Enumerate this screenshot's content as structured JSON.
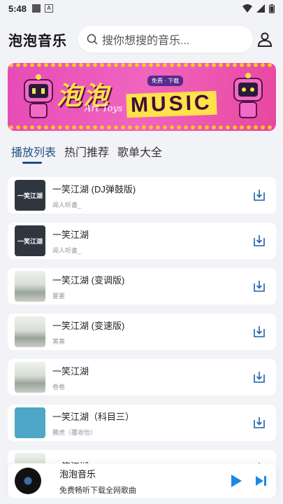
{
  "status": {
    "time": "5:48"
  },
  "header": {
    "title": "泡泡音乐"
  },
  "search": {
    "placeholder": "搜你想搜的音乐..."
  },
  "banner": {
    "title": "泡泡",
    "music": "MUSIC",
    "sub": "Art Toys",
    "pill": "免费 · 下载"
  },
  "tabs": [
    {
      "label": "播放列表",
      "active": true
    },
    {
      "label": "热门推荐",
      "active": false
    },
    {
      "label": "歌单大全",
      "active": false
    }
  ],
  "songs": [
    {
      "title": "一笑江湖 (DJ弹鼓版)",
      "artist": "闻人听書_",
      "cover": "dark",
      "cover_text": "一笑江湖"
    },
    {
      "title": "一笑江湖",
      "artist": "闻人听書_",
      "cover": "dark",
      "cover_text": "一笑江湖"
    },
    {
      "title": "一笑江湖 (变调版)",
      "artist": "要要",
      "cover": "ink",
      "cover_text": ""
    },
    {
      "title": "一笑江湖 (变速版)",
      "artist": "黄黄",
      "cover": "ink",
      "cover_text": ""
    },
    {
      "title": "一笑江湖",
      "artist": "卷卷",
      "cover": "ink",
      "cover_text": ""
    },
    {
      "title": "一笑江湖（科目三）",
      "artist": "騰虎（覆收怡）",
      "cover": "blue",
      "cover_text": ""
    },
    {
      "title": "一笑江湖",
      "artist": "",
      "cover": "ink",
      "cover_text": ""
    }
  ],
  "player": {
    "title": "泡泡音乐",
    "subtitle": "免费畅听下载全网歌曲"
  },
  "colors": {
    "accent": "#1f4f86",
    "play": "#1e88e5"
  }
}
